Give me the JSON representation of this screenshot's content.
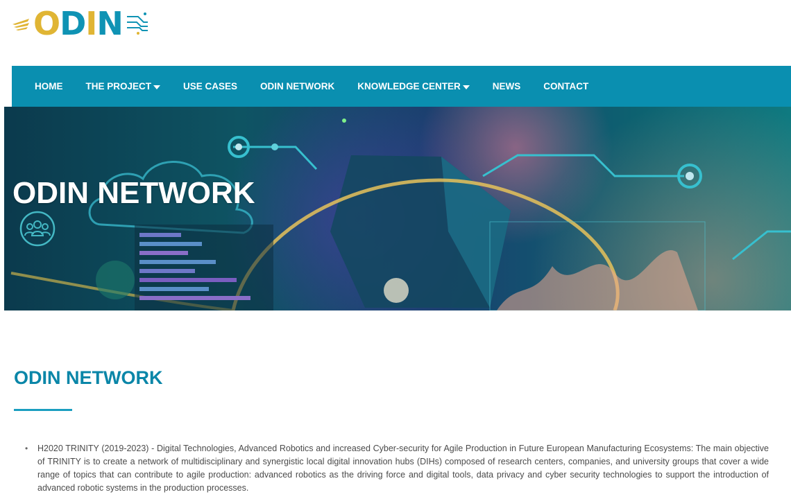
{
  "logo": {
    "text_parts": [
      "O",
      "D",
      "I",
      "N"
    ],
    "icons": [
      "logo-wing-icon",
      "logo-circuit-icon"
    ],
    "colors": {
      "gold": "#e0b534",
      "teal": "#0f93b4"
    }
  },
  "nav": {
    "items": [
      {
        "label": "HOME",
        "dropdown": false
      },
      {
        "label": "THE PROJECT",
        "dropdown": true
      },
      {
        "label": "USE CASES",
        "dropdown": false
      },
      {
        "label": "ODIN NETWORK",
        "dropdown": false
      },
      {
        "label": "KNOWLEDGE CENTER",
        "dropdown": true
      },
      {
        "label": "NEWS",
        "dropdown": false
      },
      {
        "label": "CONTACT",
        "dropdown": false
      }
    ],
    "background_color": "#0a8fb0"
  },
  "hero": {
    "title": "ODIN NETWORK",
    "icon": "people-group-icon"
  },
  "content": {
    "heading": "ODIN NETWORK",
    "accent_color": "#0a86a8",
    "bullets": [
      "H2020 TRINITY (2019-2023) - Digital Technologies, Advanced Robotics and increased Cyber-security for Agile Production in Future European Manufacturing Ecosystems: The main objective of TRINITY is to create a network of multidisciplinary and synergistic local digital innovation hubs (DIHs) composed of research centers, companies, and university groups that cover a wide range of topics that can contribute to agile production: advanced robotics as the driving force and digital tools, data privacy and cyber security technologies to support the introduction of advanced robotic systems in the production processes."
    ]
  }
}
